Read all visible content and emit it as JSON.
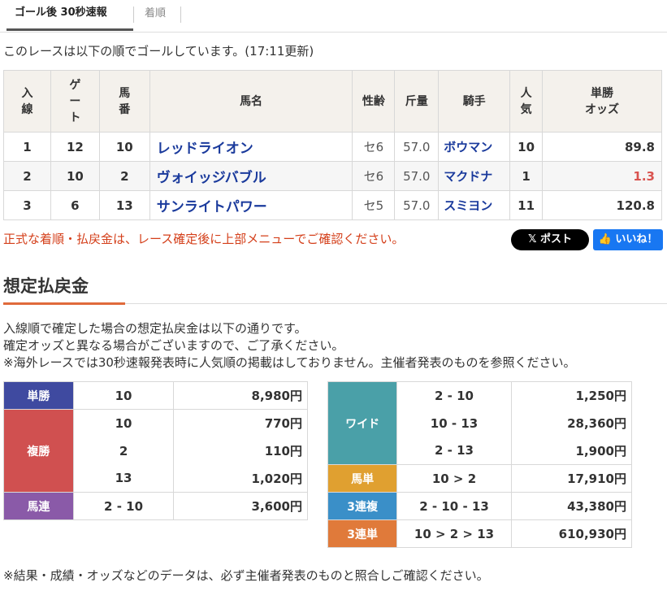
{
  "tabs": {
    "active": "ゴール後 30秒速報",
    "other": "着順"
  },
  "intro": "このレースは以下の順でゴールしています。(17:11更新)",
  "table_headers": {
    "order": "入\n線",
    "gate": "ゲ\nー\nト",
    "number": "馬\n番",
    "horse": "馬名",
    "sex_age": "性齢",
    "weight": "斤量",
    "jockey": "騎手",
    "popularity": "人\n気",
    "odds": "単勝\nオッズ"
  },
  "results": [
    {
      "order": "1",
      "gate": "12",
      "number": "10",
      "horse": "レッドライオン",
      "sex_age": "セ6",
      "weight": "57.0",
      "jockey": "ボウマン",
      "popularity": "10",
      "odds": "89.8"
    },
    {
      "order": "2",
      "gate": "10",
      "number": "2",
      "horse": "ヴォイッジバブル",
      "sex_age": "セ6",
      "weight": "57.0",
      "jockey": "マクドナ",
      "popularity": "1",
      "odds": "1.3"
    },
    {
      "order": "3",
      "gate": "6",
      "number": "13",
      "horse": "サンライトパワー",
      "sex_age": "セ5",
      "weight": "57.0",
      "jockey": "スミヨン",
      "popularity": "11",
      "odds": "120.8"
    }
  ],
  "notice": "正式な着順・払戻金は、レース確定後に上部メニューでご確認ください。",
  "social": {
    "post": "ポスト",
    "like": "いいね！"
  },
  "section_title": "想定払戻金",
  "description": [
    "入線順で確定した場合の想定払戻金は以下の通りです。",
    "確定オッズと異なる場合がございますので、ご了承ください。",
    "※海外レースでは30秒速報発表時に人気順の掲載はしておりません。主催者発表のものを参照ください。"
  ],
  "payout_left": {
    "tansho": {
      "label": "単勝",
      "combo": "10",
      "amount": "8,980円"
    },
    "fukusho": {
      "label": "複勝",
      "rows": [
        {
          "combo": "10",
          "amount": "770円"
        },
        {
          "combo": "2",
          "amount": "110円"
        },
        {
          "combo": "13",
          "amount": "1,020円"
        }
      ]
    },
    "umaren": {
      "label": "馬連",
      "combo": "2 - 10",
      "amount": "3,600円"
    }
  },
  "payout_right": {
    "wide": {
      "label": "ワイド",
      "rows": [
        {
          "combo": "2 - 10",
          "amount": "1,250円"
        },
        {
          "combo": "10 - 13",
          "amount": "28,360円"
        },
        {
          "combo": "2 - 13",
          "amount": "1,900円"
        }
      ]
    },
    "umatan": {
      "label": "馬単",
      "combo": "10 > 2",
      "amount": "17,910円"
    },
    "sanrenpuku": {
      "label": "3連複",
      "combo": "2 - 10 - 13",
      "amount": "43,380円"
    },
    "sanrentan": {
      "label": "3連単",
      "combo": "10 > 2 > 13",
      "amount": "610,930円"
    }
  },
  "footer": "※結果・成績・オッズなどのデータは、必ず主催者発表のものと照合しご確認ください。",
  "colors": {
    "tansho": "#3f4aa0",
    "fukusho": "#d05050",
    "umaren": "#8a5aa8",
    "wide": "#4aa0a8",
    "umatan": "#e0a030",
    "sanrenpuku": "#3a8fc8",
    "sanrentan": "#e07a3a",
    "accent": "#e06a3b"
  }
}
